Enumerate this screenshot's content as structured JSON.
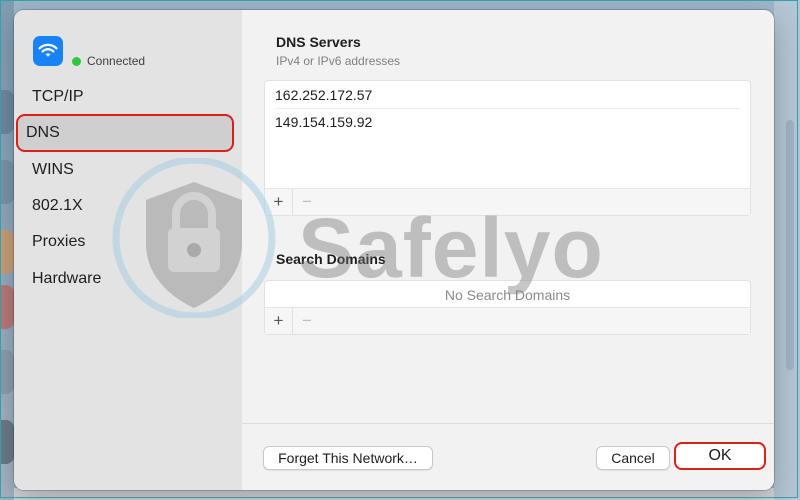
{
  "sidebar": {
    "status_text": "Connected",
    "items": [
      {
        "label": "TCP/IP"
      },
      {
        "label": "DNS",
        "selected": true
      },
      {
        "label": "WINS"
      },
      {
        "label": "802.1X"
      },
      {
        "label": "Proxies"
      },
      {
        "label": "Hardware"
      }
    ]
  },
  "dns": {
    "title": "DNS Servers",
    "subtitle": "IPv4 or IPv6 addresses",
    "servers": [
      "162.252.172.57",
      "149.154.159.92"
    ],
    "add_label": "+",
    "remove_label": "−"
  },
  "search": {
    "title": "Search Domains",
    "empty_text": "No Search Domains",
    "add_label": "+",
    "remove_label": "−"
  },
  "footer": {
    "forget_label": "Forget This Network…",
    "cancel_label": "Cancel",
    "ok_label": "OK"
  },
  "watermark": {
    "text": "Safelyo"
  },
  "colors": {
    "accent": "#1a82f7",
    "highlight": "#d9201b",
    "status": "#29c840"
  },
  "icons": {
    "wifi": "wifi-icon"
  }
}
